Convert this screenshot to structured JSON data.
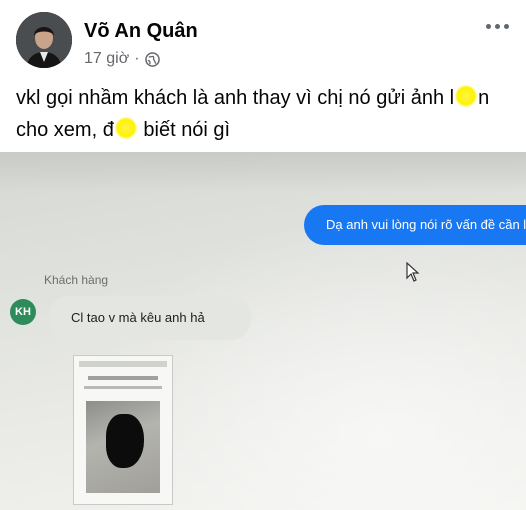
{
  "post": {
    "author": "Võ An Quân",
    "time": "17 giờ",
    "separator": "·",
    "text_part1": "vkl gọi nhầm khách là anh thay vì chị nó gửi ảnh l",
    "text_part2": "n cho xem, đ",
    "text_part3": " biết nói gì"
  },
  "icons": {
    "privacy": "globe-icon",
    "more": "more-horizontal-icon",
    "cursor": "mouse-pointer-icon"
  },
  "chat": {
    "sent_message": "Dạ anh vui lòng nói rõ vấn đề cần l",
    "sender_label": "Khách hàng",
    "avatar_initials": "KH",
    "received_message": "Cl tao v mà kêu anh hả"
  },
  "colors": {
    "sent_bubble": "#1877f2",
    "received_bubble": "#e4e6e2",
    "kh_avatar": "#2e8b5a",
    "meta_text": "#65676b"
  }
}
